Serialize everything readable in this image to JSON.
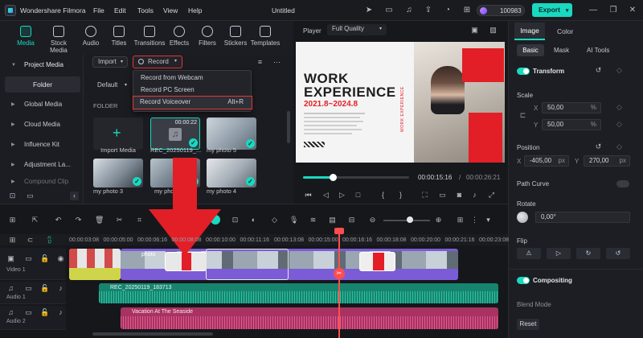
{
  "app": {
    "name": "Wondershare Filmora",
    "menus": [
      "File",
      "Edit",
      "Tools",
      "View",
      "Help"
    ],
    "project_title": "Untitled",
    "credits": "100983",
    "export_label": "Export"
  },
  "toolbar": {
    "tabs": [
      "Media",
      "Stock Media",
      "Audio",
      "Titles",
      "Transitions",
      "Effects",
      "Filters",
      "Stickers",
      "Templates"
    ],
    "active": "Media"
  },
  "sidebar": {
    "project_media": "Project Media",
    "folder": "Folder",
    "items": [
      "Global Media",
      "Cloud Media",
      "Influence Kit",
      "Adjustment La...",
      "Compound Clip"
    ]
  },
  "media": {
    "import_label": "Import",
    "record_label": "Record",
    "default_label": "Default",
    "folder_heading": "FOLDER",
    "record_menu": [
      {
        "label": "Record from Webcam",
        "shortcut": ""
      },
      {
        "label": "Record PC Screen",
        "shortcut": ""
      },
      {
        "label": "Record Voiceover",
        "shortcut": "Alt+R"
      }
    ],
    "thumbs": [
      {
        "label": "Import Media",
        "duration": ""
      },
      {
        "label": "REC_20250119_...",
        "duration": "00:00:22"
      },
      {
        "label": "my photo 5",
        "duration": ""
      },
      {
        "label": "my photo 3",
        "duration": ""
      },
      {
        "label": "my photo 1",
        "duration": ""
      },
      {
        "label": "my photo 4",
        "duration": ""
      }
    ]
  },
  "player": {
    "label": "Player",
    "quality": "Full Quality",
    "frame_title_line1": "WORK",
    "frame_title_line2": "EXPERIENCE",
    "frame_years": "2021.8~2024.8",
    "frame_side_text": "WORK EXPERIENCE",
    "current_time": "00:00:15:16",
    "separator": "/",
    "total_time": "00:00:26:21",
    "progress": 0.28
  },
  "inspector": {
    "tabs": [
      "Image",
      "Color"
    ],
    "subtabs": [
      "Basic",
      "Mask",
      "AI Tools"
    ],
    "transform_label": "Transform",
    "scale_label": "Scale",
    "scale_x": "50,00",
    "scale_y": "50,00",
    "scale_unit": "%",
    "axis_x": "X",
    "axis_y": "Y",
    "position_label": "Position",
    "pos_x": "-405,00",
    "pos_y": "270,00",
    "pos_unit": "px",
    "path_curve_label": "Path Curve",
    "rotate_label": "Rotate",
    "rotate_value": "0,00°",
    "flip_label": "Flip",
    "compositing_label": "Compositing",
    "blend_mode_label": "Blend Mode",
    "reset_label": "Reset"
  },
  "timeline": {
    "ruler": [
      "00:00:03:08",
      "00:00:05:00",
      "00:00:06:16",
      "00:00:08:08",
      "00:00:10:00",
      "00:00:11:16",
      "00:00:13:08",
      "00:00:15:00",
      "00:00:16:16",
      "00:00:18:08",
      "00:00:20:00",
      "00:00:21:16",
      "00:00:23:08"
    ],
    "tracks": [
      {
        "name": "Video 1",
        "number": "1"
      },
      {
        "name": "Audio 1",
        "number": "1"
      },
      {
        "name": "Audio 2",
        "number": "2"
      }
    ],
    "video_clip_label": "photo",
    "audio1_clip_label": "REC_20250119_183713",
    "audio2_clip_label": "Vacation At The Seaside"
  },
  "colors": {
    "accent": "#19d9c0",
    "highlight": "#e53535",
    "video_clip": "#7b5cd6",
    "audio1": "#1aa58a",
    "audio2": "#c43e73"
  }
}
